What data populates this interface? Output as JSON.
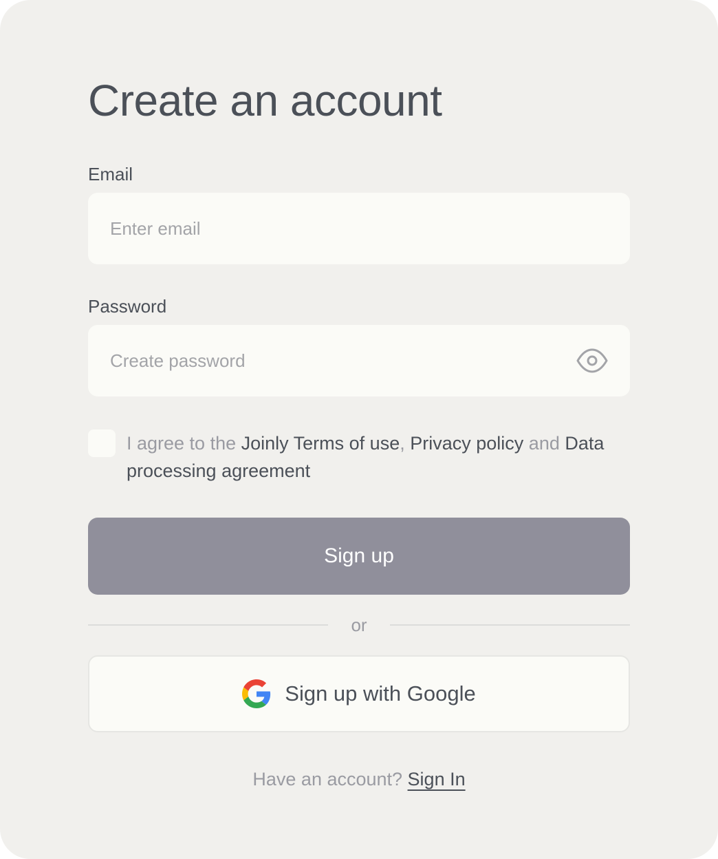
{
  "title": "Create an account",
  "email": {
    "label": "Email",
    "placeholder": "Enter email",
    "value": ""
  },
  "password": {
    "label": "Password",
    "placeholder": "Create password",
    "value": "",
    "toggle_icon": "eye-icon"
  },
  "agreement": {
    "checked": false,
    "prefix": "I agree to the ",
    "terms": "Joinly Terms of use",
    "comma": ", ",
    "privacy": "Privacy policy",
    "and": " and ",
    "dpa": "Data processing agreement"
  },
  "primary_button": {
    "label": "Sign up",
    "color": "#908f9b"
  },
  "divider_text": "or",
  "google_button": {
    "label": "Sign up with Google",
    "icon": "google-icon"
  },
  "footer": {
    "prompt": "Have an account? ",
    "link": "Sign In"
  }
}
